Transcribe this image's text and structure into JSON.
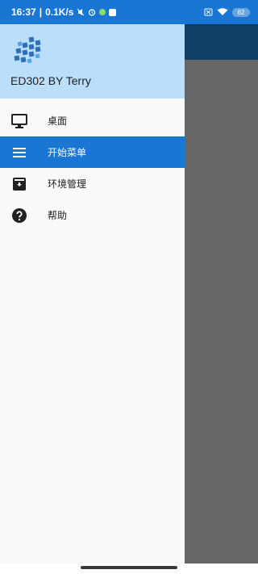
{
  "status_bar": {
    "time": "16:37",
    "network_speed": "0.1K/s",
    "battery": "62"
  },
  "drawer": {
    "title": "ED302 BY Terry",
    "items": [
      {
        "label": "桌面",
        "icon": "monitor-icon",
        "active": false
      },
      {
        "label": "开始菜单",
        "icon": "menu-icon",
        "active": true
      },
      {
        "label": "环境管理",
        "icon": "archive-icon",
        "active": false
      },
      {
        "label": "帮助",
        "icon": "help-icon",
        "active": false
      }
    ]
  },
  "colors": {
    "primary": "#1976D2",
    "header_bg": "#BBDEFB",
    "scrim": "#666666",
    "app_bar": "#0F3E66"
  }
}
